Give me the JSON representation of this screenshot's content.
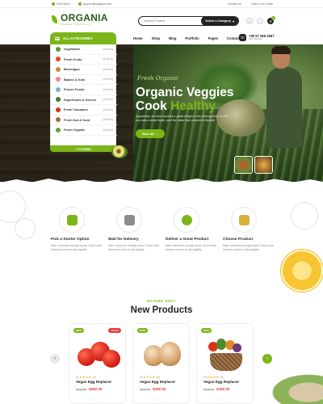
{
  "topbar": {
    "address": "Find Store",
    "email": "support@organia.com",
    "contact": "Contact us",
    "track": "Track Your Order"
  },
  "header": {
    "logo_name": "ORGANIA",
    "logo_tagline": "FRESH PRODUCT",
    "search_placeholder": "Search Product",
    "search_category": "Select a Category",
    "cart_count": "0"
  },
  "nav": {
    "categories_label": "ALL CATEGORIES",
    "links": [
      "Home",
      "Shop",
      "Blog",
      "Portfolio",
      "Pages",
      "Contacts"
    ],
    "phone_number": "+90 57 555 4567",
    "phone_support": "24/7 Support"
  },
  "categories": [
    {
      "name": "Vegetables",
      "count": "(8 Items)",
      "color": "#5c9a2c"
    },
    {
      "name": "Fresh Fruits",
      "count": "(8 Items)",
      "color": "#e2452b"
    },
    {
      "name": "Beverages",
      "count": "(8 Items)",
      "color": "#c98b3a"
    },
    {
      "name": "Babies & Kids",
      "count": "(8 Items)",
      "color": "#e88aa0"
    },
    {
      "name": "Frozen Foods",
      "count": "(8 Items)",
      "color": "#7fb0d6"
    },
    {
      "name": "Superfoods & Greens",
      "count": "(8 Items)",
      "color": "#3f7a2a"
    },
    {
      "name": "Fresh Tomatoes",
      "count": "(8 Items)",
      "color": "#d2301e"
    },
    {
      "name": "Fresh Nut & Seed",
      "count": "(8 Items)",
      "color": "#a66c34"
    },
    {
      "name": "Fresh Organic",
      "count": "(8 Items)",
      "color": "#6a9b3a"
    }
  ],
  "categories_more": "+ OTHERS",
  "hero": {
    "script": "Fresh Organic",
    "title_line1": "Organic Veggies",
    "title_line2_a": "Cook ",
    "title_line2_b": "Healthy",
    "subtitle": "Apparently we had reached a great height in the atmosphere, for the sky was a dead black, and the stars had ceased to twinkle.",
    "button": "View All"
  },
  "features": [
    {
      "title": "Pick a Starter Option",
      "desc": "Nam commodo suscipit quam. Nunc nulla. Aenean ut eros et nisl sagittis.",
      "color": "#7cb518"
    },
    {
      "title": "Wait for Delivery",
      "desc": "Nam commodo suscipit quam. Nunc nulla. Aenean ut eros et nisl sagittis.",
      "color": "#8c8c8c"
    },
    {
      "title": "Deliver a Great Product",
      "desc": "Nam commodo suscipit quam. Nunc nulla. Aenean ut eros et nisl sagittis.",
      "color": "#7cb518"
    },
    {
      "title": "Choose Product",
      "desc": "Nam commodo suscipit quam. Nunc nulla. Aenean ut eros et nisl sagittis.",
      "color": "#d9b13a"
    }
  ],
  "products_section": {
    "tag": "NATURE ONLY",
    "title": "New Products"
  },
  "products": [
    {
      "name": "Vegan Egg Replacer",
      "old_price": "$310.00",
      "price": "$280.00",
      "stars": "★★★★★",
      "reviews": "(8)",
      "badge_new": "NEW",
      "badge_sale": "-SALE!"
    },
    {
      "name": "Vegan Egg Replacer",
      "old_price": "$310.00",
      "price": "$280.00",
      "stars": "★★★★★",
      "reviews": "(8)",
      "badge_new": "NEW"
    },
    {
      "name": "Vegan Egg Replacer",
      "old_price": "$310.00",
      "price": "$280.00",
      "stars": "★★★★★",
      "reviews": "(8)",
      "badge_new": "NEW"
    }
  ],
  "icons": {
    "prev": "‹",
    "next": "›",
    "search": "⌕",
    "heart": "♡",
    "user": "☺",
    "cart": "⊕",
    "phone": "☏",
    "chevron": "▾",
    "arrow": "→"
  },
  "colors": {
    "accent": "#7cb518",
    "sale": "#e43c3c",
    "dark": "#222222"
  }
}
